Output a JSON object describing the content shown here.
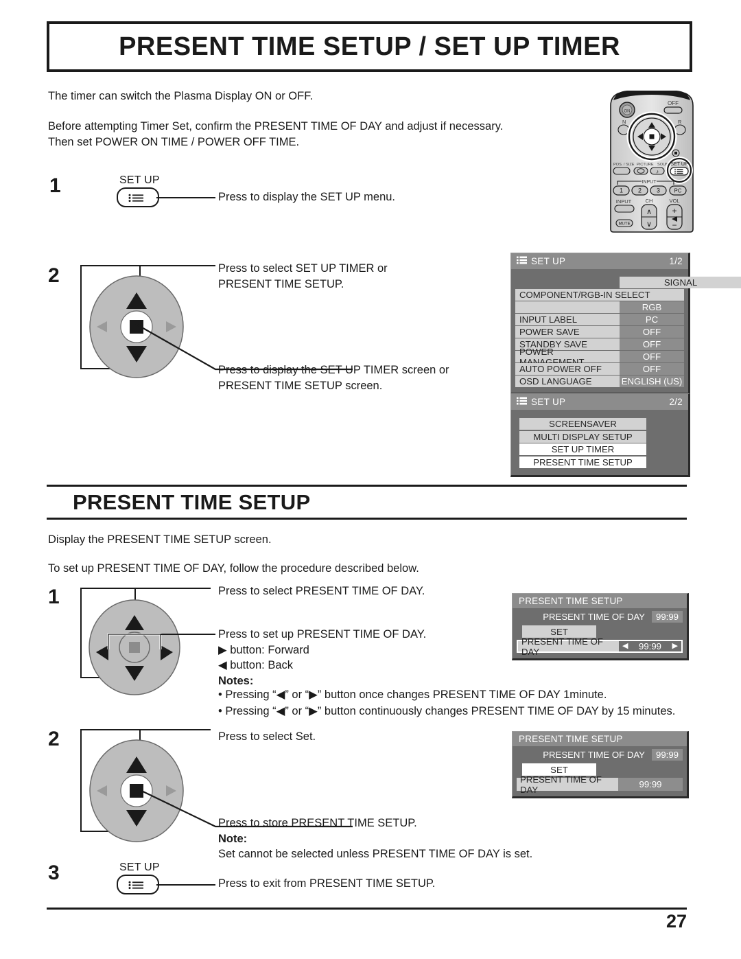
{
  "page": {
    "title": "PRESENT TIME SETUP / SET UP TIMER",
    "page_number": "27"
  },
  "intro": {
    "line1": "The timer can switch the Plasma Display ON or OFF.",
    "line2": "Before attempting Timer Set, confirm the PRESENT TIME OF DAY and adjust if necessary.",
    "line3": "Then set POWER ON TIME / POWER OFF TIME."
  },
  "steps_top": [
    {
      "number": "1",
      "key_label": "SET UP",
      "text": "Press to display the SET UP menu."
    },
    {
      "number": "2",
      "text_up_1": "Press to select SET UP TIMER or",
      "text_up_2": "PRESENT TIME SETUP.",
      "text_enter_1": "Press to display the SET UP TIMER screen or",
      "text_enter_2": "PRESENT TIME SETUP screen."
    }
  ],
  "section": {
    "heading": "PRESENT TIME SETUP",
    "line1": "Display the PRESENT TIME SETUP screen.",
    "line2": "To set up PRESENT TIME OF DAY, follow the procedure described below."
  },
  "steps_bottom": [
    {
      "number": "1",
      "text_up": "Press to select PRESENT TIME OF DAY.",
      "text_lr": "Press to set up PRESENT TIME OF DAY.",
      "forward": "▶ button: Forward",
      "back": "◀ button: Back",
      "notes_head": "Notes:",
      "note1": "• Pressing “◀” or “▶” button once changes PRESENT TIME OF DAY 1minute.",
      "note2": "• Pressing “◀” or “▶” button continuously changes PRESENT TIME OF DAY by 15 minutes."
    },
    {
      "number": "2",
      "text_up": "Press to select Set.",
      "text_enter": "Press to store PRESENT TIME SETUP.",
      "note_head": "Note:",
      "note": "Set cannot be selected unless PRESENT TIME OF DAY is set."
    },
    {
      "number": "3",
      "key_label": "SET UP",
      "text": "Press to exit from PRESENT TIME SETUP."
    }
  ],
  "osd_setup_1": {
    "icon": "menu-list-icon",
    "title": "SET UP",
    "page": "1/2",
    "rows": [
      {
        "name": "SIGNAL",
        "value": "",
        "style": "wide"
      },
      {
        "name": "COMPONENT/RGB-IN SELECT",
        "value": "",
        "style": "full"
      },
      {
        "name": "",
        "value": "RGB",
        "style": "valueonly"
      },
      {
        "name": "INPUT LABEL",
        "value": "PC",
        "style": "pair"
      },
      {
        "name": "POWER SAVE",
        "value": "OFF",
        "style": "pair"
      },
      {
        "name": "STANDBY SAVE",
        "value": "OFF",
        "style": "pair"
      },
      {
        "name": "POWER MANAGEMENT",
        "value": "OFF",
        "style": "pair"
      },
      {
        "name": "AUTO POWER OFF",
        "value": "OFF",
        "style": "pair"
      },
      {
        "name": "OSD LANGUAGE",
        "value": "ENGLISH (US)",
        "style": "pair"
      }
    ]
  },
  "osd_setup_2": {
    "icon": "menu-list-icon",
    "title": "SET UP",
    "page": "2/2",
    "items": [
      {
        "label": "SCREENSAVER",
        "highlighted": false
      },
      {
        "label": "MULTI DISPLAY SETUP",
        "highlighted": false
      },
      {
        "label": "SET UP TIMER",
        "highlighted": true
      },
      {
        "label": "PRESENT TIME SETUP",
        "highlighted": true
      }
    ]
  },
  "osd_pts_1": {
    "title": "PRESENT  TIME SETUP",
    "present_label": "PRESENT  TIME OF DAY",
    "present_value": "99:99",
    "set_label": "SET",
    "row_label": "PRESENT  TIME OF DAY",
    "row_value": "99:99",
    "left_arrow": "◀",
    "right_arrow": "▶"
  },
  "osd_pts_2": {
    "title": "PRESENT  TIME SETUP",
    "present_label": "PRESENT  TIME OF DAY",
    "present_value": "99:99",
    "set_label": "SET",
    "row_label": "PRESENT  TIME OF DAY",
    "row_value": "99:99"
  },
  "remote": {
    "on": "ON",
    "off": "OFF",
    "n": "N",
    "r": "R",
    "pos_size": "POS. / SIZE",
    "picture": "PICTURE",
    "sound": "SOUND",
    "set_up": "SET UP",
    "input_group": "INPUT",
    "b1": "1",
    "b2": "2",
    "b3": "3",
    "pc": "PC",
    "input": "INPUT",
    "ch": "CH",
    "vol": "VOL",
    "plus": "+",
    "minus": "−",
    "up": "∧",
    "down": "∨",
    "mute": "MUTE"
  },
  "colors": {
    "osd_header": "#8c8c8c",
    "osd_body": "#6e6e6e",
    "osd_row": "#d2d2d2",
    "osd_value": "#8d8d8d",
    "highlight": "#ffffff",
    "ink": "#1a1a1a",
    "dpad_face": "#b8b8b8"
  }
}
